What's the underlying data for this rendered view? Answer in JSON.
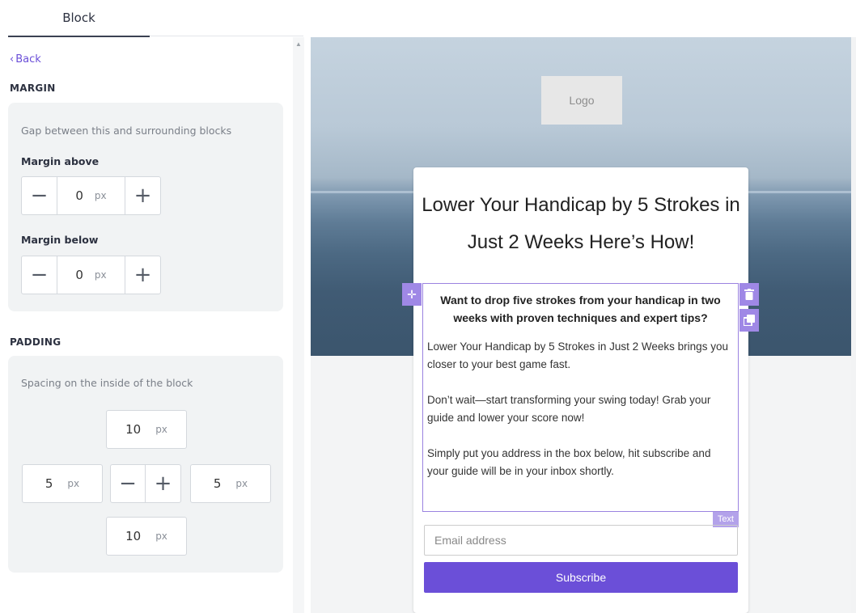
{
  "tabs": {
    "active": "Block"
  },
  "panel": {
    "back_label": "Back",
    "margin": {
      "title": "MARGIN",
      "description": "Gap between this and surrounding blocks",
      "above_label": "Margin above",
      "above_value": "0",
      "below_label": "Margin below",
      "below_value": "0",
      "unit": "px"
    },
    "padding": {
      "title": "PADDING",
      "description": "Spacing on the inside of the block",
      "top": "10",
      "left": "5",
      "right": "5",
      "bottom": "10",
      "unit": "px"
    }
  },
  "preview": {
    "logo_text": "Logo",
    "headline": "Lower Your Handicap by 5 Strokes in Just 2 Weeks Here’s How!",
    "text_block": {
      "lead": "Want to drop five strokes from your handicap in two weeks with proven techniques and expert tips?",
      "para1": "Lower Your Handicap by 5 Strokes in Just 2 Weeks brings you closer to your best game fast.",
      "para2": "Don’t wait—start transforming your swing today! Grab your guide and lower your score now!",
      "para3": "Simply put you address in the box below, hit subscribe and your guide will be in your inbox shortly.",
      "tag": "Text"
    },
    "email_placeholder": "Email address",
    "subscribe_label": "Subscribe"
  },
  "colors": {
    "accent": "#6b4fd8",
    "selection": "#9f88e6"
  },
  "icons": [
    "chevron-left-icon",
    "minus-icon",
    "plus-icon",
    "move-icon",
    "trash-icon",
    "duplicate-icon",
    "scroll-up-icon"
  ]
}
